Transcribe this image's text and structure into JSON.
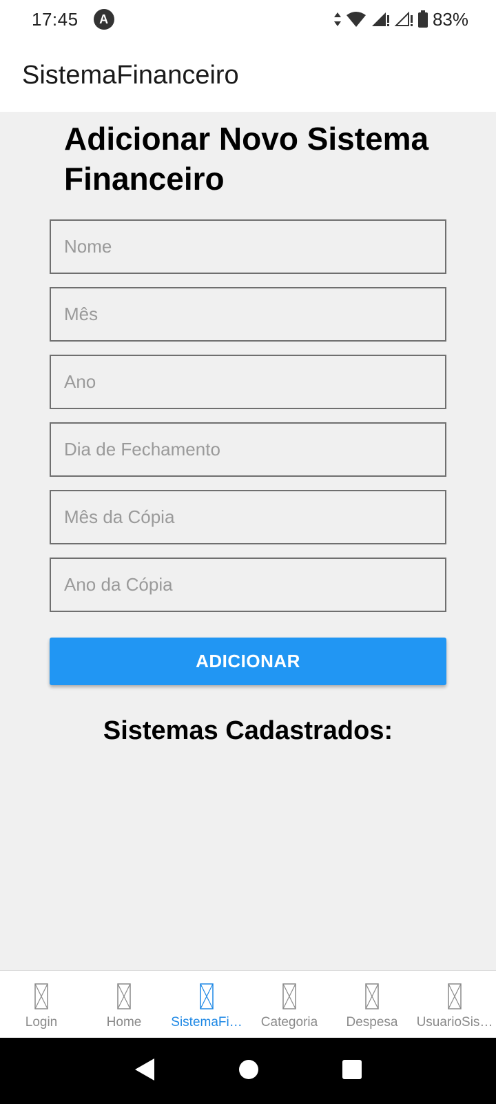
{
  "status_bar": {
    "time": "17:45",
    "app_badge_icon": "A",
    "battery": "83%"
  },
  "app_bar": {
    "title": "SistemaFinanceiro"
  },
  "form": {
    "heading": "Adicionar Novo Sistema Financeiro",
    "fields": [
      {
        "placeholder": "Nome",
        "value": ""
      },
      {
        "placeholder": "Mês",
        "value": ""
      },
      {
        "placeholder": "Ano",
        "value": ""
      },
      {
        "placeholder": "Dia de Fechamento",
        "value": ""
      },
      {
        "placeholder": "Mês da Cópia",
        "value": ""
      },
      {
        "placeholder": "Ano da Cópia",
        "value": ""
      }
    ],
    "submit_label": "ADICIONAR"
  },
  "list": {
    "title": "Sistemas Cadastrados:"
  },
  "tabs": [
    {
      "label": "Login",
      "active": false
    },
    {
      "label": "Home",
      "active": false
    },
    {
      "label": "SistemaFi…",
      "active": true
    },
    {
      "label": "Categoria",
      "active": false
    },
    {
      "label": "Despesa",
      "active": false
    },
    {
      "label": "UsuarioSis…",
      "active": false
    }
  ],
  "colors": {
    "accent": "#2196f3",
    "active_tab": "#1e88e5",
    "inactive_tab": "#8a8a8a",
    "background": "#f0f0f0"
  }
}
